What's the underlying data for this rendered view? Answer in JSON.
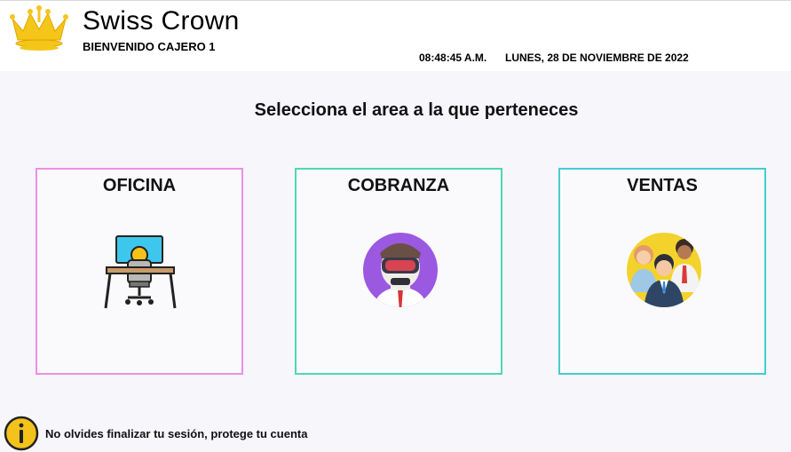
{
  "header": {
    "brand_title": "Swiss Crown",
    "welcome": "BIENVENIDO CAJERO 1",
    "time": "08:48:45 A.M.",
    "date": "LUNES, 28 DE NOVIEMBRE DE 2022",
    "logo_icon": "crown-icon",
    "logo_color": "#f5c61a"
  },
  "main": {
    "prompt": "Selecciona el area a la que perteneces",
    "areas": [
      {
        "title": "OFICINA",
        "icon": "office-desk-icon",
        "border_color": "#ee8fe3"
      },
      {
        "title": "COBRANZA",
        "icon": "collector-avatar-icon",
        "border_color": "#4fd7b3"
      },
      {
        "title": "VENTAS",
        "icon": "sales-team-icon",
        "border_color": "#45cdd0"
      }
    ]
  },
  "footer": {
    "notice": "No olvides finalizar tu sesión, protege tu cuenta",
    "icon": "info-icon",
    "icon_color": "#f3c21b"
  }
}
